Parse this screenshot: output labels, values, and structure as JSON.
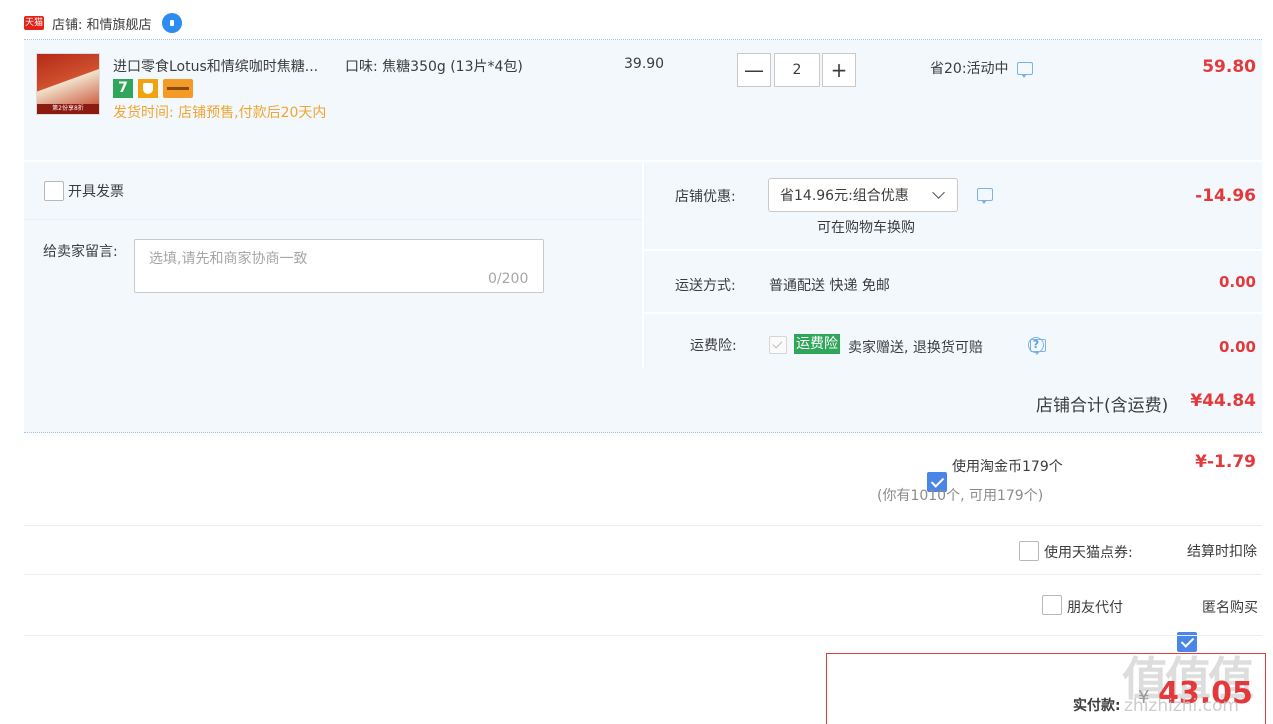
{
  "shop": {
    "badge": "天猫",
    "name": "店铺: 和情旗舰店"
  },
  "item": {
    "title": "进口零食Lotus和情缤咖时焦糖...",
    "thumb_strip": "第2份享8折",
    "tag_7": "7",
    "ship_info": "发货时间: 店铺预售,付款后20天内",
    "sku": "口味: 焦糖350g (13片*4包)",
    "unit_price": "39.90",
    "qty_minus": "—",
    "quantity": "2",
    "qty_plus": "+",
    "promo": "省20:活动中",
    "total": "59.80"
  },
  "options": {
    "invoice_label": "开具发票",
    "message_label": "给卖家留言:",
    "message_placeholder": "选填,请先和商家协商一致",
    "message_count": "0/200",
    "store_discount_label": "店铺优惠:",
    "store_discount_value": "省14.96元:组合优惠",
    "store_discount_hint": "可在购物车换购",
    "store_discount_amt": "-14.96",
    "shipping_label": "运送方式:",
    "shipping_value": "普通配送 快递 免邮",
    "shipping_amt": "0.00",
    "insurance_label": "运费险:",
    "insurance_badge": "运费险",
    "insurance_value": "卖家赠送, 退换货可赔",
    "insurance_amt": "0.00"
  },
  "store_total": {
    "label": "店铺合计(含运费)",
    "value": "¥44.84"
  },
  "coins": {
    "label": "使用淘金币179个",
    "note": "(你有1010个, 可用179个)",
    "amt": "¥-1.79",
    "checked": true
  },
  "tmall_points": {
    "label": "使用天猫点券:",
    "value": "结算时扣除"
  },
  "friend_pay": {
    "label": "朋友代付",
    "checked": false
  },
  "anonymous": {
    "label": "匿名购买",
    "checked": true
  },
  "pay": {
    "label": "实付款:",
    "currency": "¥",
    "amount": "43.05"
  },
  "watermark": {
    "main": "值值值",
    "sub": "zhizhizhi.com"
  },
  "colors": {
    "price_red": "#e4393c",
    "panel_bg": "#f3f8fd",
    "orange_text": "#f2a532",
    "checkbox_blue": "#4a86e8",
    "badge_green": "#30a65b"
  }
}
